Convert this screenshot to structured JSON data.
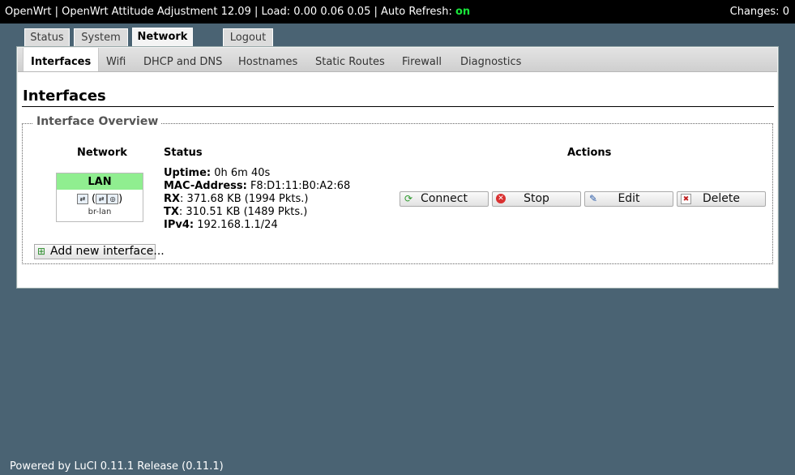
{
  "topbar": {
    "hostname": "OpenWrt",
    "release": "OpenWrt Attitude Adjustment 12.09",
    "load_label": "Load:",
    "load_value": "0.00 0.06 0.05",
    "refresh_label": "Auto Refresh:",
    "refresh_value": "on",
    "changes_label": "Changes:",
    "changes_value": "0",
    "separator": "|"
  },
  "main_tabs": [
    {
      "label": "Status"
    },
    {
      "label": "System"
    },
    {
      "label": "Network",
      "active": true
    },
    {
      "label": "Logout"
    }
  ],
  "sub_tabs": [
    {
      "label": "Interfaces",
      "active": true
    },
    {
      "label": "Wifi"
    },
    {
      "label": "DHCP and DNS"
    },
    {
      "label": "Hostnames"
    },
    {
      "label": "Static Routes"
    },
    {
      "label": "Firewall"
    },
    {
      "label": "Diagnostics"
    }
  ],
  "page": {
    "title": "Interfaces",
    "section_title": "Interface Overview",
    "columns": {
      "network": "Network",
      "status": "Status",
      "actions": "Actions"
    }
  },
  "interface": {
    "name": "LAN",
    "name_color": "#90ee90",
    "device": "br-lan",
    "icons": [
      "ethernet-icon",
      "bridge-open-icon",
      "ethernet-port-icon",
      "wifi-icon",
      "bridge-close-icon"
    ],
    "uptime_label": "Uptime:",
    "uptime_value": "0h 6m 40s",
    "mac_label": "MAC-Address:",
    "mac_value": "F8:D1:11:B0:A2:68",
    "rx_label": "RX",
    "rx_value": ": 371.68 KB (1994 Pkts.)",
    "tx_label": "TX",
    "tx_value": ": 310.51 KB (1489 Pkts.)",
    "ipv4_label": "IPv4:",
    "ipv4_value": "192.168.1.1/24"
  },
  "actions": {
    "connect": "Connect",
    "stop": "Stop",
    "edit": "Edit",
    "delete": "Delete"
  },
  "add_interface": "Add new interface...",
  "footer": "Powered by LuCI 0.11.1 Release (0.11.1)"
}
